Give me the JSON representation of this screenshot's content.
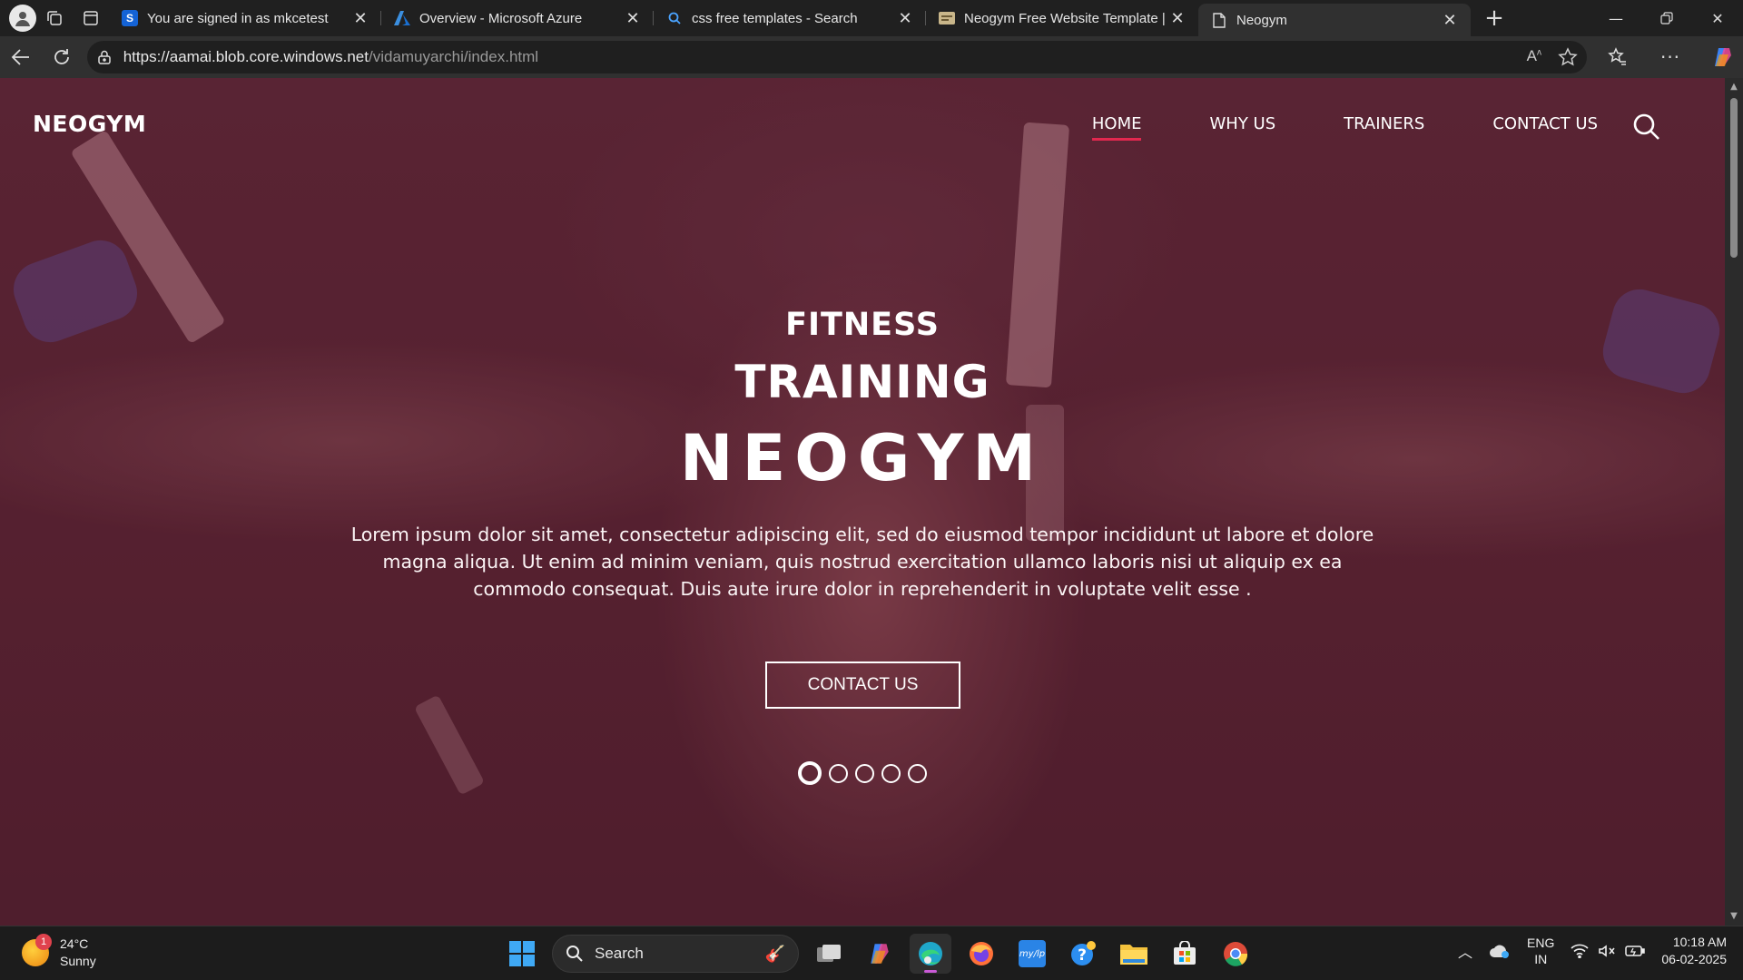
{
  "browser": {
    "tabs": [
      {
        "label": "You are signed in as mkcetest",
        "icon": "sharepoint-s-icon",
        "active": false
      },
      {
        "label": "Overview - Microsoft Azure",
        "icon": "azure-icon",
        "active": false
      },
      {
        "label": "css free templates - Search",
        "icon": "search-icon",
        "active": false
      },
      {
        "label": "Neogym Free Website Template |",
        "icon": "template-site-icon",
        "active": false
      },
      {
        "label": "Neogym",
        "icon": "page-icon",
        "active": true
      }
    ],
    "favicon_letters": {
      "sharepoint": "S"
    },
    "address": {
      "host": "https://aamai.blob.core.windows.net",
      "path": "/vidamuyarchi/index.html"
    }
  },
  "site": {
    "logo": "NEOGYM",
    "nav": [
      "HOME",
      "WHY US",
      "TRAINERS",
      "CONTACT US"
    ],
    "active_nav": "HOME",
    "hero": {
      "line1": "FITNESS",
      "line2": "TRAINING",
      "line3": "NEOGYM",
      "description": "Lorem ipsum dolor sit amet, consectetur adipiscing elit, sed do eiusmod tempor incididunt ut labore et dolore magna aliqua. Ut enim ad minim veniam, quis nostrud exercitation ullamco laboris nisi ut aliquip ex ea commodo consequat. Duis aute irure dolor in reprehenderit in voluptate velit esse .",
      "cta": "CONTACT US",
      "slides": 5,
      "active_slide": 1
    },
    "colors": {
      "accent": "#e2284f",
      "overlay": "#5a2836"
    }
  },
  "taskbar": {
    "weather": {
      "temp": "24°C",
      "condition": "Sunny",
      "badge": "1"
    },
    "search_label": "Search",
    "lang": {
      "line1": "ENG",
      "line2": "IN"
    },
    "clock": {
      "time": "10:18 AM",
      "date": "06-02-2025"
    }
  }
}
